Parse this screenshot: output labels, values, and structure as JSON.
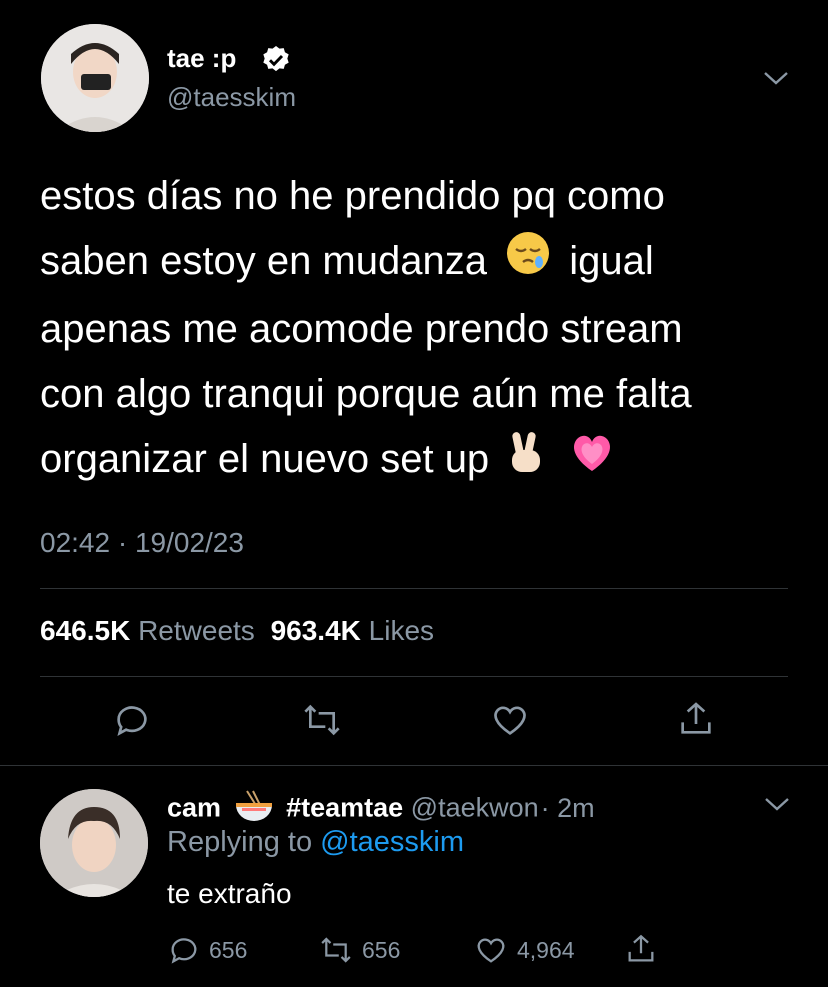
{
  "tweet": {
    "name": "tae :p",
    "handle": "@taesskim",
    "text_line1": "estos días no he prendido pq como",
    "text_line2a": "saben estoy en mudanza",
    "text_line2b": "igual",
    "text_line3": "apenas me acomode prendo stream",
    "text_line4": "con algo tranqui porque aún me falta",
    "text_line5": "organizar el nuevo set up",
    "timestamp": "02:42 · 19/02/23",
    "retweets_count": "646.5K",
    "retweets_label": "Retweets",
    "likes_count": "963.4K",
    "likes_label": "Likes"
  },
  "reply": {
    "name": "cam",
    "hashtag": "#teamtae",
    "handle": "@taekwon",
    "time": "· 2m",
    "replying_prefix": "Replying to",
    "replying_mention": "@taesskim",
    "text": "te extraño",
    "reply_count": "656",
    "retweet_count": "656",
    "like_count": "4,964"
  },
  "icons": {
    "verified": "verified-badge-icon",
    "chevron": "chevron-down-icon",
    "reply": "reply-icon",
    "retweet": "retweet-icon",
    "like": "heart-icon",
    "share": "share-icon"
  },
  "colors": {
    "background": "#000000",
    "muted": "#8b98a5",
    "accent": "#1d9bf0",
    "divider": "#2f3336"
  }
}
